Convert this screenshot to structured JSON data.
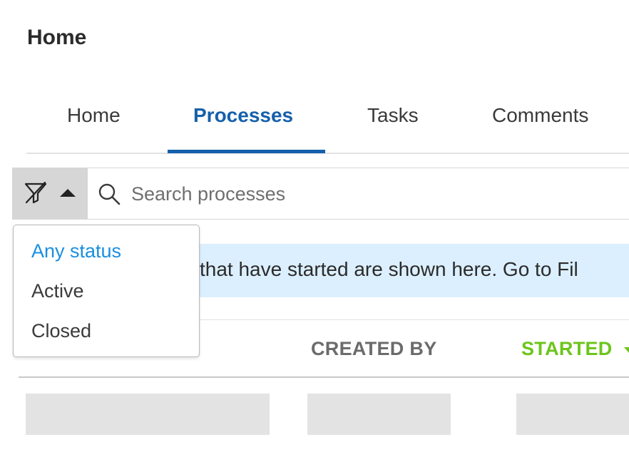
{
  "page": {
    "title": "Home"
  },
  "tabs": [
    {
      "label": "Home",
      "active": false
    },
    {
      "label": "Processes",
      "active": true
    },
    {
      "label": "Tasks",
      "active": false
    },
    {
      "label": "Comments",
      "active": false
    }
  ],
  "search": {
    "placeholder": "Search processes",
    "value": "",
    "filter_icon": "filter-off-icon",
    "search_icon": "search-icon"
  },
  "status_filter": {
    "options": [
      {
        "label": "Any status",
        "selected": true
      },
      {
        "label": "Active",
        "selected": false
      },
      {
        "label": "Closed",
        "selected": false
      }
    ]
  },
  "info_banner": {
    "text": "that have started are shown here. Go to Fil"
  },
  "table": {
    "columns": [
      {
        "label": "CREATED BY",
        "sorted": false
      },
      {
        "label": "STARTED",
        "sorted": true,
        "sort_direction": "desc"
      }
    ]
  },
  "colors": {
    "accent": "#1560ab",
    "selected_option": "#1a8fe0",
    "sorted_column": "#6cc51c",
    "banner_bg": "#dcefff",
    "filter_bg": "#d6d6d6"
  }
}
